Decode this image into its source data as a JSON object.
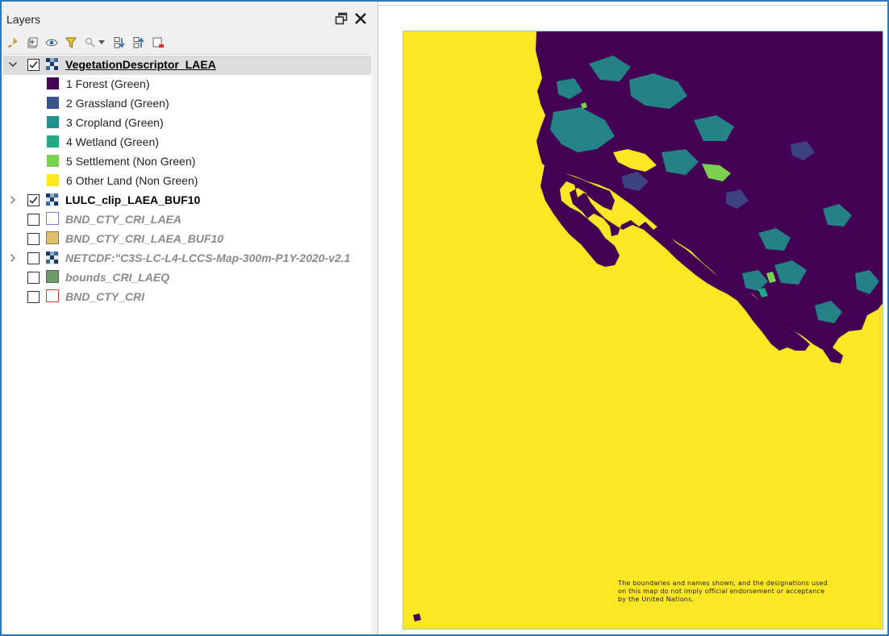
{
  "panel": {
    "title": "Layers"
  },
  "header_icons": [
    "undock-icon",
    "close-icon"
  ],
  "toolbar_icons": [
    "style-brush-icon",
    "add-group-icon",
    "visibility-eye-icon",
    "filter-icon",
    "filter-legend-icon",
    "expand-all-icon",
    "collapse-all-icon",
    "remove-layer-icon"
  ],
  "layers": [
    {
      "name": "VegetationDescriptor_LAEA",
      "checked": true,
      "expanded": true,
      "type": "raster",
      "legend": [
        {
          "label": "1 Forest (Green)",
          "color": "#440154"
        },
        {
          "label": "2 Grassland (Green)",
          "color": "#3b528b"
        },
        {
          "label": "3 Cropland (Green)",
          "color": "#21918c"
        },
        {
          "label": "4 Wetland (Green)",
          "color": "#21a884"
        },
        {
          "label": "5 Settlement (Non Green)",
          "color": "#7ad151"
        },
        {
          "label": "6 Other Land (Non Green)",
          "color": "#fde725"
        }
      ]
    },
    {
      "name": "LULC_clip_LAEA_BUF10",
      "checked": true,
      "expanded": false,
      "type": "raster"
    },
    {
      "name": "BND_CTY_CRI_LAEA",
      "checked": false,
      "type": "polygon",
      "fill": "#ffffff",
      "stroke": "#7b7fd6"
    },
    {
      "name": "BND_CTY_CRI_LAEA_BUF10",
      "checked": false,
      "type": "polygon",
      "fill": "#dfc26b",
      "stroke": "#8b7b4a"
    },
    {
      "name": "NETCDF:\"C3S-LC-L4-LCCS-Map-300m-P1Y-2020-v2.1",
      "checked": false,
      "expanded": false,
      "type": "raster"
    },
    {
      "name": "bounds_CRI_LAEQ",
      "checked": false,
      "type": "polygon",
      "fill": "#6f9a6d",
      "stroke": "#4d6b4b"
    },
    {
      "name": "BND_CTY_CRI",
      "checked": false,
      "type": "polygon",
      "fill": "#ffffff",
      "stroke": "#d23a3a"
    }
  ],
  "map": {
    "background_color": "#fde725",
    "disclaimer_lines": [
      "The boundaries and names shown, and the designations used",
      "on this map do not imply official endorsement or acceptance",
      "by the United Nations."
    ]
  }
}
